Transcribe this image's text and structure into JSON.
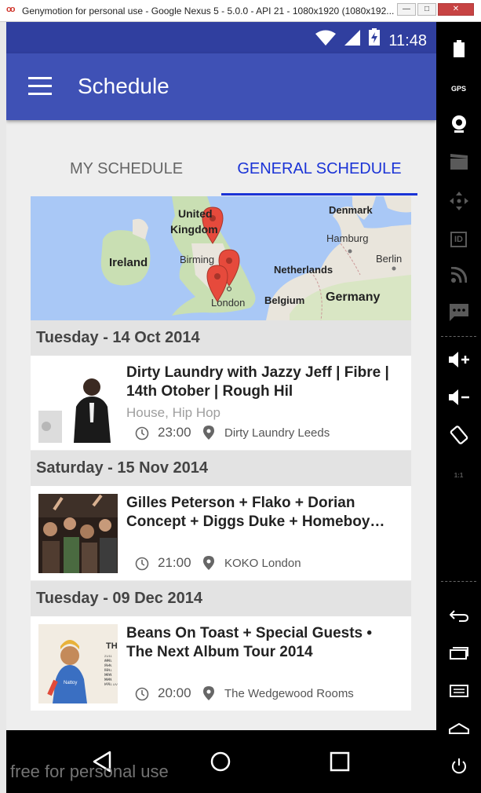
{
  "window": {
    "title": "Genymotion for personal use - Google Nexus 5 - 5.0.0 - API 21 - 1080x1920 (1080x192...",
    "min": "—",
    "max": "□",
    "close": "✕"
  },
  "status_bar": {
    "time": "11:48",
    "icons": [
      "wifi-icon",
      "signal-icon",
      "battery-charging-icon"
    ]
  },
  "app_bar": {
    "title": "Schedule"
  },
  "tabs": [
    {
      "label": "MY SCHEDULE",
      "selected": false
    },
    {
      "label": "GENERAL SCHEDULE",
      "selected": true
    }
  ],
  "map": {
    "labels": {
      "uk_1": "United",
      "uk_2": "Kingdom",
      "ireland": "Ireland",
      "denmark": "Denmark",
      "hamburg": "Hamburg",
      "birmingham": "Birming",
      "netherlands": "Netherlands",
      "berlin": "Berlin",
      "london": "London",
      "belgium": "Belgium",
      "germany": "Germany"
    },
    "marker_count": 3,
    "colors": {
      "water": "#a9c8f6",
      "land": "#e9e5dc",
      "green": "#c9dfb3",
      "marker": "#e64a3c"
    }
  },
  "days": [
    {
      "date": "Tuesday - 14 Oct 2014",
      "events": [
        {
          "title": "Dirty Laundry with Jazzy Jeff | Fibre | 14th Otober | Rough Hil",
          "genre": "House, Hip Hop",
          "time": "23:00",
          "venue": "Dirty Laundry Leeds"
        }
      ]
    },
    {
      "date": "Saturday - 15 Nov 2014",
      "events": [
        {
          "title": "Gilles Peterson + Flako + Dorian Concept + Diggs Duke + Homeboy…",
          "genre": "",
          "time": "21:00",
          "venue": "KOKO London"
        }
      ]
    },
    {
      "date": "Tuesday - 09 Dec 2014",
      "events": [
        {
          "title": "Beans On Toast + Special Guests • The Next Album Tour 2014",
          "genre": "",
          "time": "20:00",
          "venue": "The Wedgewood Rooms"
        }
      ]
    }
  ],
  "thumb_text": {
    "th": "TH",
    "poster_1": "21/11 ABE",
    "poster_2": "22/11 GLA",
    "poster_3": "23/11 EDI",
    "poster_4": "24/11 NEW",
    "poster_5": "25/11 MAN",
    "poster_6": "26/11 LEE",
    "poster_7": "27/11 LIV",
    "shirt": "Nattoy"
  },
  "side_toolbar": {
    "items": [
      "battery-icon",
      "gps-icon",
      "webcam-icon",
      "clapper-icon",
      "dpad-icon",
      "id-icon",
      "rss-icon",
      "sms-icon",
      "volume-up-icon",
      "volume-down-icon",
      "rotate-icon",
      "scale-icon",
      "back-icon",
      "recent-icon",
      "menu-icon",
      "home-icon",
      "power-icon"
    ],
    "gps_label": "GPS",
    "id_label": "ID",
    "scale_label": "1:1"
  },
  "watermark": "free for personal use",
  "colors": {
    "primary": "#3f51b5",
    "primary_dark": "#303f9f",
    "tab_selected": "#1a33d6"
  }
}
